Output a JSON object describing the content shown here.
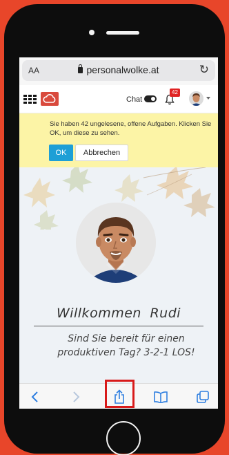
{
  "browser": {
    "aa_label": "AA",
    "url": "personalwolke.at"
  },
  "app": {
    "chat_label": "Chat",
    "notification_count": "42"
  },
  "banner": {
    "message": "Sie haben 42 ungelesene, offene Aufgaben. Klicken Sie OK, um diese zu sehen.",
    "ok_label": "OK",
    "cancel_label": "Abbrechen"
  },
  "main": {
    "welcome": "Willkommen Rudi",
    "subtitle_line1": "Sind Sie bereit für einen",
    "subtitle_line2": "produktiven Tag? 3-2-1 LOS!"
  },
  "toolbar": {
    "icons": [
      "back-icon",
      "forward-icon",
      "share-icon",
      "bookmarks-icon",
      "tabs-icon"
    ]
  },
  "colors": {
    "frame_background": "#e8462a",
    "accent_blue": "#1e9fd6",
    "banner_yellow": "#fcf4a6",
    "logo_red": "#d94a3d",
    "highlight_red": "#d81a1a",
    "ios_blue": "#2f7fe0"
  }
}
